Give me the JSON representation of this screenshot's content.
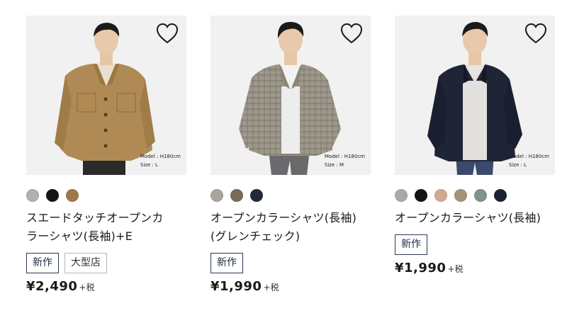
{
  "products": [
    {
      "name_lines": [
        "スエードタッチオープンカ",
        "ラーシャツ(長袖)+E"
      ],
      "model_height": "Model : H180cm",
      "model_size": "Size : L",
      "swatches": [
        "#b2b0ad",
        "#151515",
        "#9e7a4a"
      ],
      "tags": [
        "新作",
        "大型店"
      ],
      "price": "¥2,490",
      "tax": "+税",
      "favorite_icon": "heart-outline-icon"
    },
    {
      "name_lines": [
        "オープンカラーシャツ(長袖)",
        "(グレンチェック)"
      ],
      "model_height": "Model : H180cm",
      "model_size": "Size : M",
      "swatches": [
        "#a9a59a",
        "#7a6a58",
        "#23273a"
      ],
      "tags": [
        "新作"
      ],
      "price": "¥1,990",
      "tax": "+税",
      "favorite_icon": "heart-outline-icon"
    },
    {
      "name_lines": [
        "オープンカラーシャツ(長袖)"
      ],
      "model_height": "Model : H180cm",
      "model_size": "Size : L",
      "swatches": [
        "#a8a8ad",
        "#141414",
        "#d2a893",
        "#a49378",
        "#7d958d",
        "#1d2234"
      ],
      "tags": [
        "新作"
      ],
      "price": "¥1,990",
      "tax": "+税",
      "favorite_icon": "heart-outline-icon"
    }
  ],
  "colors": {
    "tag_new_border": "#2b3a55",
    "tag_border": "#b9b9b9",
    "photo_bg": "#f1f1f1"
  }
}
